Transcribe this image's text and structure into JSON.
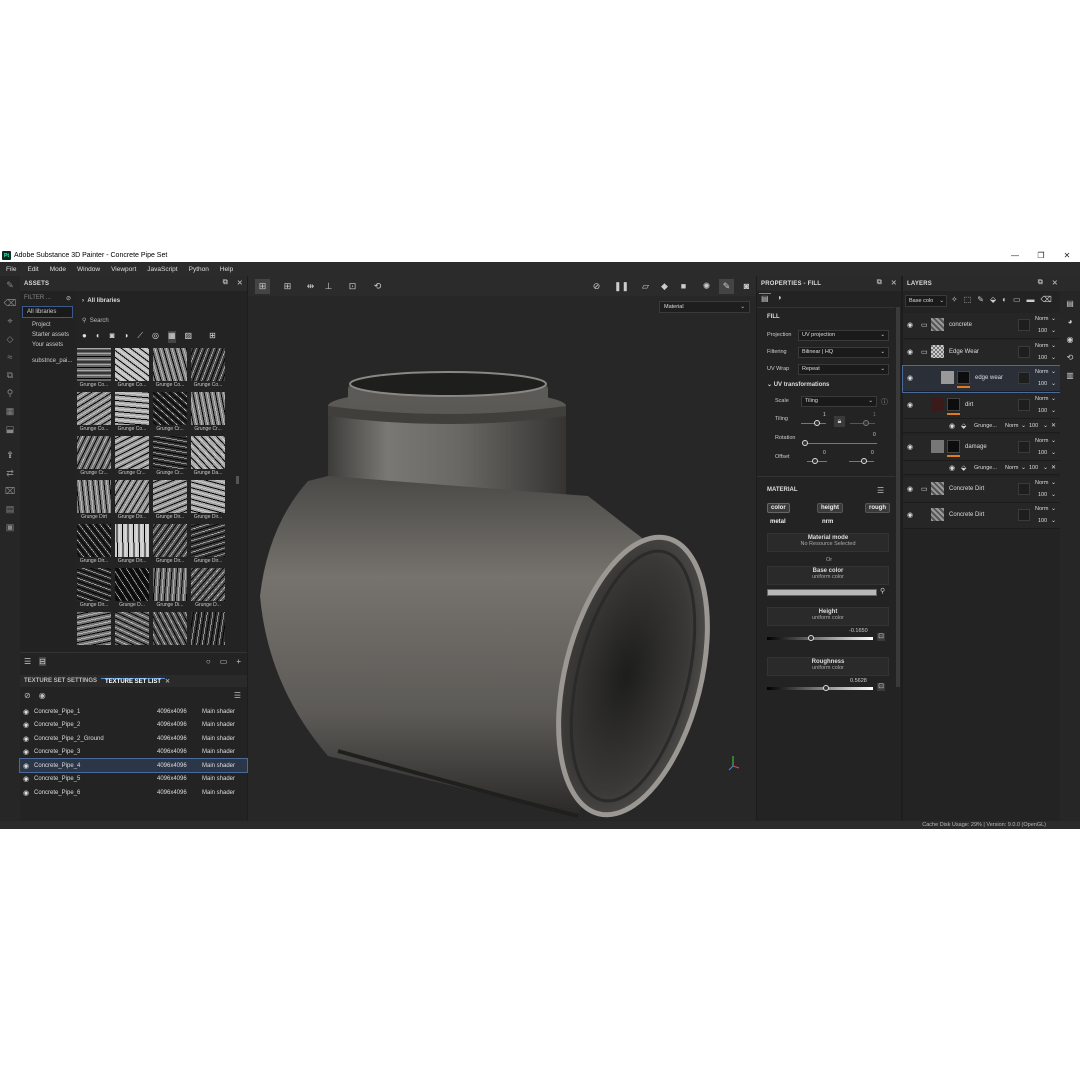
{
  "window": {
    "title": "Adobe Substance 3D Painter - Concrete Pipe Set",
    "logo": "Pt"
  },
  "menu": [
    "File",
    "Edit",
    "Mode",
    "Window",
    "Viewport",
    "JavaScript",
    "Python",
    "Help"
  ],
  "assets": {
    "header": "ASSETS",
    "filter": "FILTER ...",
    "libraries": [
      "All libraries",
      "Project",
      "Starter assets",
      "Your assets",
      "substnce_pai..."
    ],
    "breadcrumb": "All libraries",
    "search_placeholder": "Search",
    "thumbnails": [
      "Grunge Co...",
      "Grunge Co...",
      "Grunge Co...",
      "Grunge Co...",
      "Grunge Co...",
      "Grunge Co...",
      "Grunge Cr...",
      "Grunge Cr...",
      "Grunge Cr...",
      "Grunge Cr...",
      "Grunge Cr...",
      "Grunge Da...",
      "Grunge Dirt",
      "Grunge Dir...",
      "Grunge Dir...",
      "Grunge Dir...",
      "Grunge Dir...",
      "Grunge Dir...",
      "Grunge Dir...",
      "Grunge Dir...",
      "Grunge Dir...",
      "Grunge D...",
      "Grunge Di...",
      "Grunge D...",
      "",
      "",
      "",
      ""
    ]
  },
  "texture_set": {
    "tabs": [
      "TEXTURE SET SETTINGS",
      "TEXTURE SET LIST"
    ],
    "rows": [
      {
        "name": "Concrete_Pipe_1",
        "res": "4096x4096",
        "shader": "Main shader"
      },
      {
        "name": "Concrete_Pipe_2",
        "res": "4096x4096",
        "shader": "Main shader"
      },
      {
        "name": "Concrete_Pipe_2_Ground",
        "res": "4096x4096",
        "shader": "Main shader"
      },
      {
        "name": "Concrete_Pipe_3",
        "res": "4096x4096",
        "shader": "Main shader"
      },
      {
        "name": "Concrete_Pipe_4",
        "res": "4096x4096",
        "shader": "Main shader"
      },
      {
        "name": "Concrete_Pipe_5",
        "res": "4096x4096",
        "shader": "Main shader"
      },
      {
        "name": "Concrete_Pipe_6",
        "res": "4096x4096",
        "shader": "Main shader"
      }
    ],
    "selected_index": 4
  },
  "viewport": {
    "mode": "Material"
  },
  "properties": {
    "header": "PROPERTIES - FILL",
    "fill_title": "FILL",
    "projection_label": "Projection",
    "projection": "UV projection",
    "filtering_label": "Filtering",
    "filtering": "Bilinear | HQ",
    "uvwrap_label": "UV Wrap",
    "uvwrap": "Repeat",
    "uvt_title": "UV transformations",
    "scale_label": "Scale",
    "scale": "Tiling",
    "tiling_label": "Tiling",
    "tiling_a": "1",
    "tiling_b": "1",
    "rotation_label": "Rotation",
    "rotation": "0",
    "offset_label": "Offset",
    "offset_a": "0",
    "offset_b": "0",
    "material_title": "MATERIAL",
    "channels": [
      "color",
      "height",
      "rough",
      "metal",
      "nrm"
    ],
    "material_mode": "Material mode",
    "material_mode_sub": "No Resource Selected",
    "or": "Or",
    "base_color": "Base color",
    "base_color_sub": "uniform color",
    "height": "Height",
    "height_sub": "uniform color",
    "height_value": "-0.1650",
    "roughness": "Roughness",
    "roughness_sub": "uniform color",
    "roughness_value": "0.5628",
    "roughness_fraction": 0.56
  },
  "layers": {
    "header": "LAYERS",
    "channel": "Base colo",
    "items": [
      {
        "name": "concrete",
        "blend": "Norm",
        "opacity": "100"
      },
      {
        "name": "Edge Wear",
        "blend": "Norm",
        "opacity": "100"
      },
      {
        "name": "edge wear",
        "blend": "Norm",
        "opacity": "100"
      },
      {
        "name": "dirt",
        "blend": "Norm",
        "opacity": "100"
      },
      {
        "name": "damage",
        "blend": "Norm",
        "opacity": "100"
      },
      {
        "name": "Concrete Dirt",
        "blend": "Norm",
        "opacity": "100"
      },
      {
        "name": "Concrete Dirt",
        "blend": "Norm",
        "opacity": "100"
      }
    ],
    "sub_items": [
      {
        "name": "Grunge...",
        "blend": "Norm",
        "opacity": "100"
      },
      {
        "name": "Grunge...",
        "blend": "Norm",
        "opacity": "100"
      }
    ]
  },
  "status": "Cache Disk Usage:   29% | Version: 9.0.0 (OpenGL)",
  "colors": {
    "accent": "#4a90d9",
    "bg": "#1d1d1d",
    "panel": "#232323",
    "edge_mask": "#e07a20"
  }
}
